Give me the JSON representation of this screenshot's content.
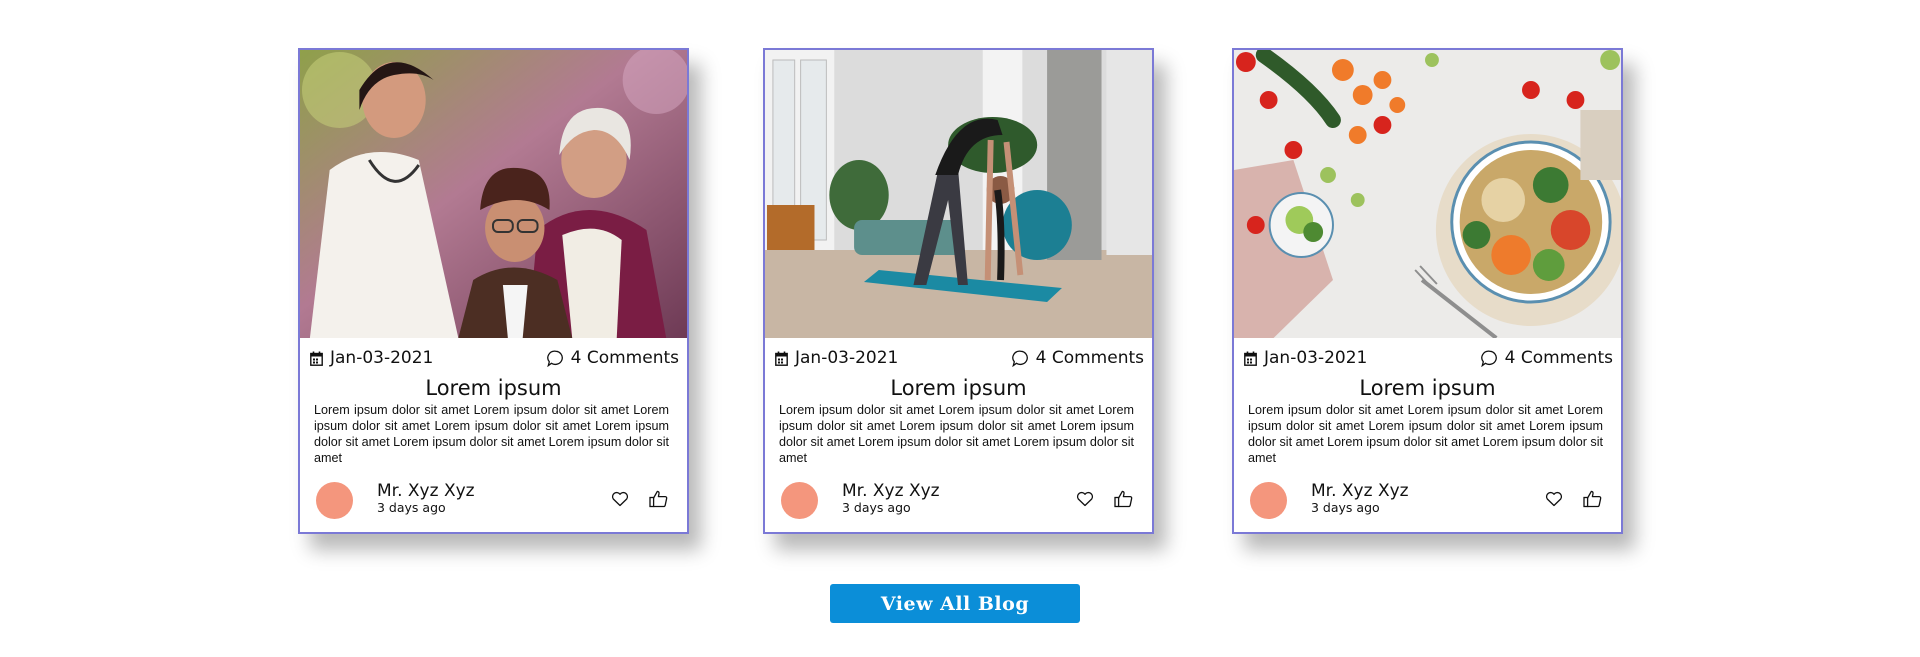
{
  "blog_cards": [
    {
      "image": "elderly-care-photo",
      "date": "Jan-03-2021",
      "comments": "4 Comments",
      "title": "Lorem ipsum",
      "excerpt": "Lorem ipsum dolor sit amet Lorem ipsum dolor sit amet Lorem ipsum dolor sit amet Lorem ipsum dolor sit amet Lorem ipsum dolor sit amet Lorem ipsum dolor sit amet Lorem ipsum dolor sit amet",
      "author": "Mr. Xyz Xyz",
      "posted": "3 days ago"
    },
    {
      "image": "yoga-stretch-photo",
      "date": "Jan-03-2021",
      "comments": "4 Comments",
      "title": "Lorem ipsum",
      "excerpt": "Lorem ipsum dolor sit amet Lorem ipsum dolor sit amet Lorem ipsum dolor sit amet Lorem ipsum dolor sit amet Lorem ipsum dolor sit amet Lorem ipsum dolor sit amet Lorem ipsum dolor sit amet",
      "author": "Mr. Xyz Xyz",
      "posted": "3 days ago"
    },
    {
      "image": "healthy-food-photo",
      "date": "Jan-03-2021",
      "comments": "4 Comments",
      "title": "Lorem ipsum",
      "excerpt": "Lorem ipsum dolor sit amet Lorem ipsum dolor sit amet Lorem ipsum dolor sit amet Lorem ipsum dolor sit amet Lorem ipsum dolor sit amet Lorem ipsum dolor sit amet Lorem ipsum dolor sit amet",
      "author": "Mr. Xyz Xyz",
      "posted": "3 days ago"
    }
  ],
  "icons": {
    "date": "calendar-icon",
    "comments": "comment-bubble-icon",
    "like": "heart-icon",
    "thumb": "thumbs-up-icon"
  },
  "colors": {
    "card_border": "#7b79d6",
    "avatar": "#f4967d",
    "button_bg": "#0b8ed8",
    "button_text": "#ffffff"
  },
  "view_all_label": "View All Blog"
}
